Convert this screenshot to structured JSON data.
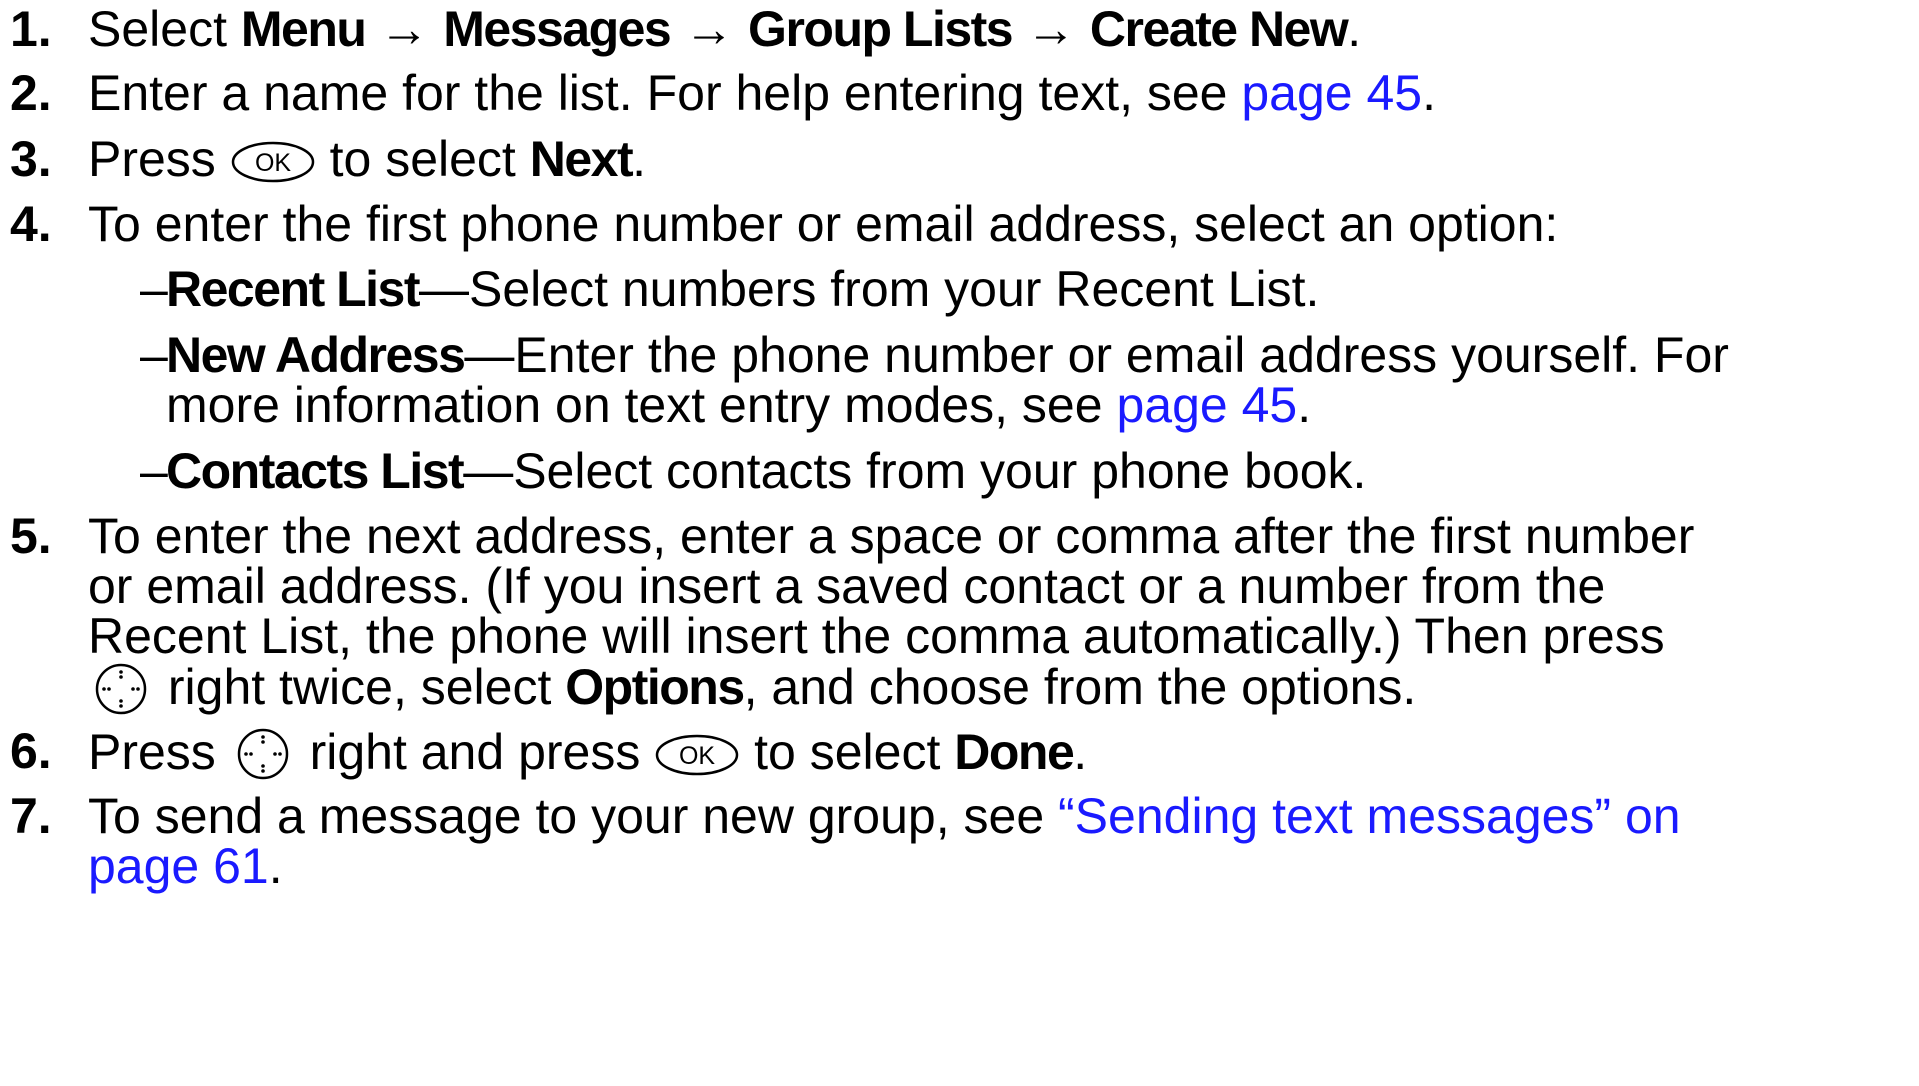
{
  "steps": {
    "s1": {
      "num": "1.",
      "pre": "Select ",
      "menu": "Menu",
      "arrow1": " → ",
      "messages": "Messages",
      "arrow2": " → ",
      "group_lists": "Group Lists",
      "arrow3": " → ",
      "create_new": "Create New",
      "end": "."
    },
    "s2": {
      "num": "2.",
      "text": "Enter a name for the list. For help entering text, see ",
      "link": "page 45",
      "end": "."
    },
    "s3": {
      "num": "3.",
      "pre": "Press ",
      "mid": " to select ",
      "next": "Next",
      "end": "."
    },
    "s4": {
      "num": "4.",
      "text": "To enter the first phone number or email address, select an option:"
    },
    "options": [
      {
        "dash": "–",
        "label": "Recent List",
        "sep": "—",
        "text": "Select numbers from your Recent List."
      },
      {
        "dash": "–",
        "label": "New Address",
        "sep": "—",
        "text": "Enter the phone number or email address yourself. For",
        "text2": "more information on text entry modes, see ",
        "link": "page 45",
        "end": "."
      },
      {
        "dash": "–",
        "label": "Contacts List",
        "sep": "—",
        "text": "Select contacts from your phone book."
      }
    ],
    "s5": {
      "num": "5.",
      "line1": "To enter the next address, enter a space or comma after the first number",
      "line2": "or email address. (If you insert a saved contact or a number from the",
      "line3": "Recent List, the phone will insert the comma automatically.) Then press",
      "line4_mid": " right twice, select ",
      "options": "Options",
      "line4_end": ", and choose from the options."
    },
    "s6": {
      "num": "6.",
      "pre": "Press ",
      "mid": " right and press ",
      "mid2": " to select ",
      "done": "Done",
      "end": "."
    },
    "s7": {
      "num": "7.",
      "text": "To send a message to your new group, see ",
      "link1": "“Sending text messages” on",
      "link2": "page 61",
      "end": "."
    }
  },
  "icons": {
    "ok_key": "ok-key-icon",
    "ok_key_label": "OK",
    "nav_key": "navigation-key-icon"
  },
  "colors": {
    "link": "#1a1aff",
    "text": "#000000"
  }
}
